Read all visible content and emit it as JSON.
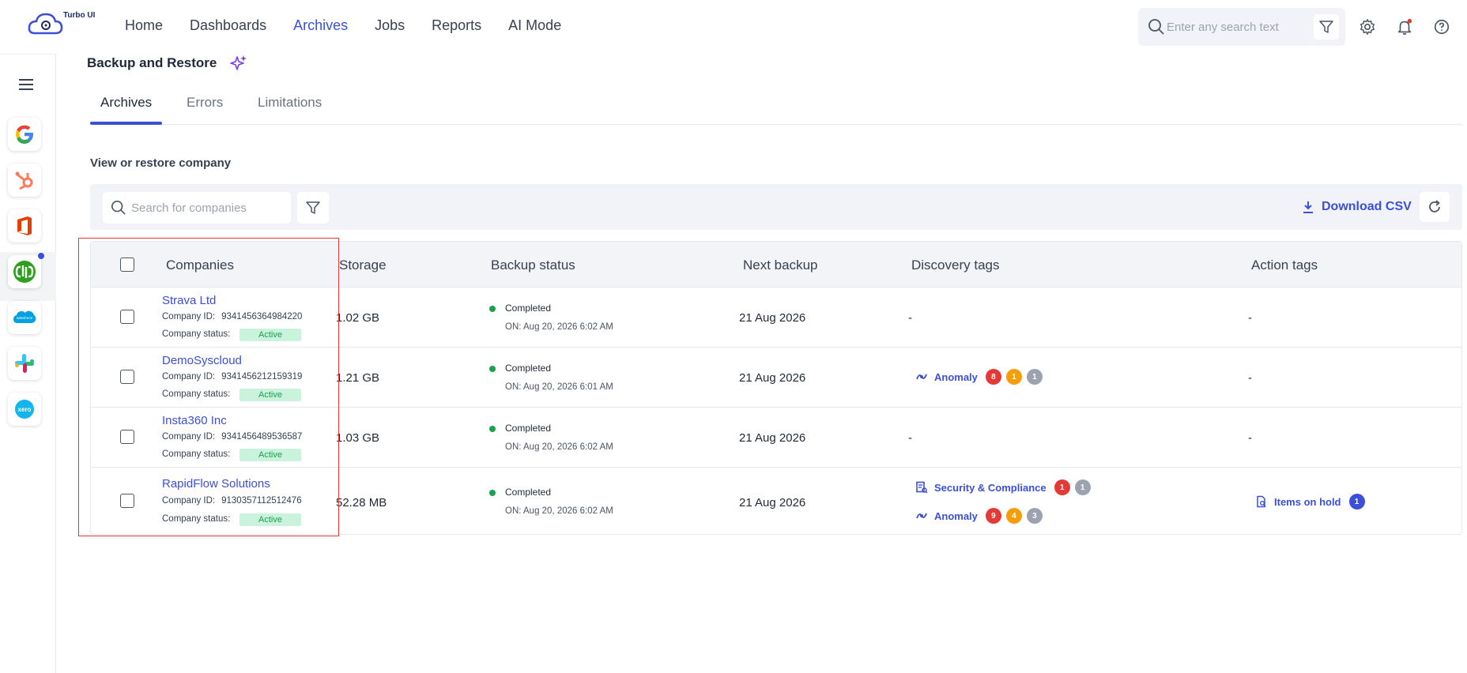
{
  "app": {
    "name": "Turbo UI"
  },
  "nav": {
    "items": [
      "Home",
      "Dashboards",
      "Archives",
      "Jobs",
      "Reports",
      "AI Mode"
    ],
    "active": "Archives"
  },
  "top_search": {
    "placeholder": "Enter any search text"
  },
  "sidebar": {
    "apps": [
      "google-icon",
      "hubspot-icon",
      "office-icon",
      "quickbooks-icon",
      "salesforce-icon",
      "slack-icon",
      "xero-icon"
    ],
    "active_app": "quickbooks-icon"
  },
  "page": {
    "title": "Backup and Restore"
  },
  "tabs": [
    "Archives",
    "Errors",
    "Limitations"
  ],
  "active_tab": "Archives",
  "section": {
    "label": "View or restore company"
  },
  "toolbar": {
    "search_placeholder": "Search for companies",
    "download_label": "Download CSV"
  },
  "table": {
    "headers": [
      "Companies",
      "Storage",
      "Backup status",
      "Next backup",
      "Discovery tags",
      "Action tags"
    ],
    "id_label": "Company ID:",
    "status_label": "Company status:",
    "rows": [
      {
        "name": "Strava Ltd",
        "id": "9341456364984220",
        "status": "Active",
        "storage": "1.02 GB",
        "backup_status": "Completed",
        "backup_on": "ON:  Aug 20, 2026 6:02 AM",
        "next_backup": "21 Aug 2026",
        "discovery_dash": "-",
        "action_dash": "-"
      },
      {
        "name": "DemoSyscloud",
        "id": "9341456212159319",
        "status": "Active",
        "storage": "1.21 GB",
        "backup_status": "Completed",
        "backup_on": "ON:  Aug 20, 2026 6:01 AM",
        "next_backup": "21 Aug 2026",
        "discovery_tags": [
          {
            "label": "Anomaly",
            "counts": [
              8,
              1,
              1
            ]
          }
        ],
        "action_dash": "-"
      },
      {
        "name": "Insta360 Inc",
        "id": "9341456489536587",
        "status": "Active",
        "storage": "1.03 GB",
        "backup_status": "Completed",
        "backup_on": "ON:  Aug 20, 2026 6:02 AM",
        "next_backup": "21 Aug 2026",
        "discovery_dash": "-",
        "action_dash": "-"
      },
      {
        "name": "RapidFlow Solutions",
        "id": "9130357112512476",
        "status": "Active",
        "storage": "52.28 MB",
        "backup_status": "Completed",
        "backup_on": "ON:  Aug 20, 2026 6:02 AM",
        "next_backup": "21 Aug 2026",
        "discovery_tags": [
          {
            "label": "Security & Compliance",
            "counts": [
              1,
              1
            ]
          },
          {
            "label": "Anomaly",
            "counts": [
              9,
              4,
              3
            ]
          }
        ],
        "action_tags": [
          {
            "label": "Items on hold",
            "counts": [
              1
            ]
          }
        ]
      }
    ]
  },
  "colors": {
    "accent": "#3b4fd8",
    "success": "#16a34a",
    "badge_red": "#e53935",
    "badge_orange": "#f59e0b",
    "badge_gray": "#9ca3af",
    "highlight": "#e53935"
  }
}
